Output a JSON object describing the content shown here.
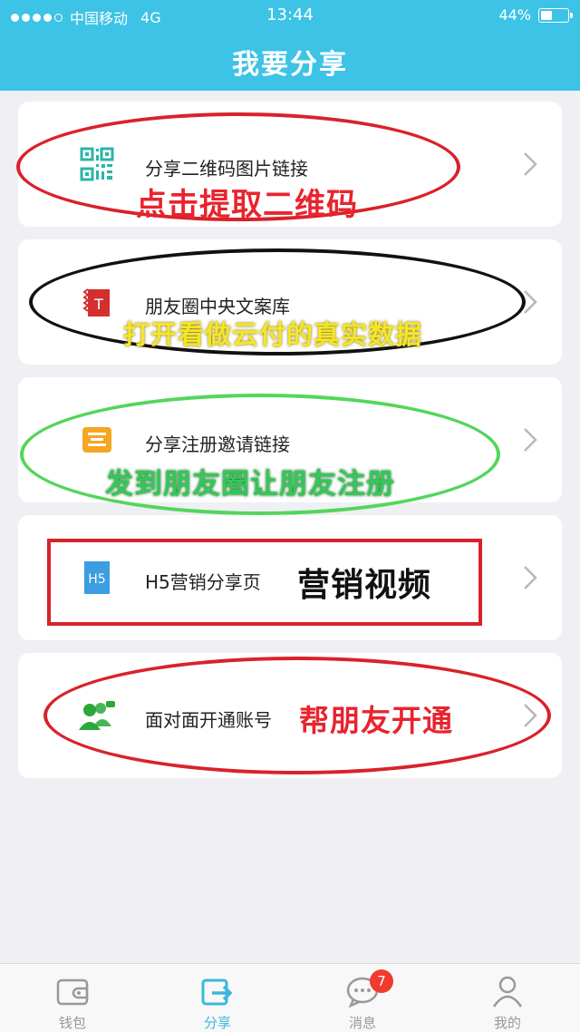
{
  "status_bar": {
    "carrier": "中国移动",
    "network": "4G",
    "time": "13:44",
    "battery_percent": "44%",
    "battery_level": 0.44
  },
  "header": {
    "title": "我要分享"
  },
  "menu": {
    "items": [
      {
        "label": "分享二维码图片链接",
        "annotation": "点击提取二维码",
        "annotation_color": "#e8242e",
        "icon": "qr-code-icon",
        "icon_color": "#2bb4a8"
      },
      {
        "label": "朋友圈中央文案库",
        "annotation": "打开看做云付的真实数据",
        "annotation_color": "#f5e625",
        "icon": "document-t-icon",
        "icon_color": "#d32f2f"
      },
      {
        "label": "分享注册邀请链接",
        "annotation": "发到朋友圈让朋友注册",
        "annotation_color": "#34c759",
        "icon": "invite-icon",
        "icon_color": "#f5a623"
      },
      {
        "label": "H5营销分享页",
        "annotation": "营销视频",
        "annotation_color": "#111111",
        "icon": "h5-icon",
        "icon_color": "#3a9ee0"
      },
      {
        "label": "面对面开通账号",
        "annotation": "帮朋友开通",
        "annotation_color": "#e8242e",
        "icon": "users-icon",
        "icon_color": "#2aa83a"
      }
    ]
  },
  "tabbar": {
    "tabs": [
      {
        "label": "钱包",
        "icon": "wallet-icon"
      },
      {
        "label": "分享",
        "icon": "share-icon"
      },
      {
        "label": "消息",
        "icon": "message-icon",
        "badge": "7"
      },
      {
        "label": "我的",
        "icon": "person-icon"
      }
    ],
    "active_index": 1
  },
  "colors": {
    "header_bg": "#3cc3e6",
    "page_bg": "#efeff4",
    "active_tab": "#3cb6dc"
  }
}
